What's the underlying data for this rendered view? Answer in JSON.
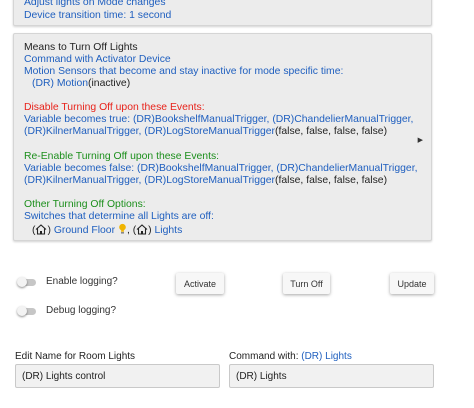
{
  "top_panel": {
    "line1": "Adjust lights on Mode changes",
    "line2": "Device transition time: 1 second"
  },
  "main_panel": {
    "means_title": "Means to Turn Off Lights",
    "command_device": "Command with Activator Device",
    "motion_text": "Motion Sensors that become and stay inactive for mode specific time:",
    "motion_sensor": "(DR) Motion",
    "motion_state": "(inactive)",
    "disable_title": "Disable Turning Off upon these Events:",
    "disable_var_prefix": "Variable becomes true: ",
    "disable_var_line1": "(DR)BookshelfManualTrigger, (DR)ChandelierManualTrigger,",
    "disable_var_line2": "(DR)KilnerManualTrigger, (DR)LogStoreManualTrigger",
    "disable_var_values": "(false, false, false, false)",
    "reenable_title": "Re-Enable Turning Off upon these Events:",
    "reenable_var_prefix": "Variable becomes false: ",
    "reenable_var_line1": "(DR)BookshelfManualTrigger, (DR)ChandelierManualTrigger,",
    "reenable_var_line2": "(DR)KilnerManualTrigger, (DR)LogStoreManualTrigger",
    "reenable_var_values": "(false, false, false, false)",
    "other_title": "Other Turning Off Options:",
    "switches_text": "Switches that determine all Lights are off:",
    "open_paren": "(",
    "ground_floor": "Ground Floor",
    "sep": ", (",
    "lights": "Lights",
    "close_paren": ")"
  },
  "toggles": {
    "enable_logging": "Enable logging?",
    "debug_logging": "Debug logging?"
  },
  "buttons": {
    "activate": "Activate",
    "turn_off": "Turn Off",
    "update": "Update"
  },
  "fields": {
    "name_label": "Edit Name for Room Lights",
    "name_value": "(DR) Lights control",
    "command_label_prefix": "Command with: ",
    "command_label_link": "(DR) Lights",
    "command_value": "(DR) Lights"
  },
  "icons": {
    "home": "home-icon",
    "bulb": "lightbulb-icon",
    "expand": "expand-arrow-icon",
    "toggle": "toggle-switch"
  },
  "colors": {
    "link_blue": "#1f5fbf",
    "disable_red": "#e8221a",
    "reenable_green": "#1c8f1c",
    "panel_bg": "#ececec",
    "bulb_yellow": "#f0b400"
  }
}
